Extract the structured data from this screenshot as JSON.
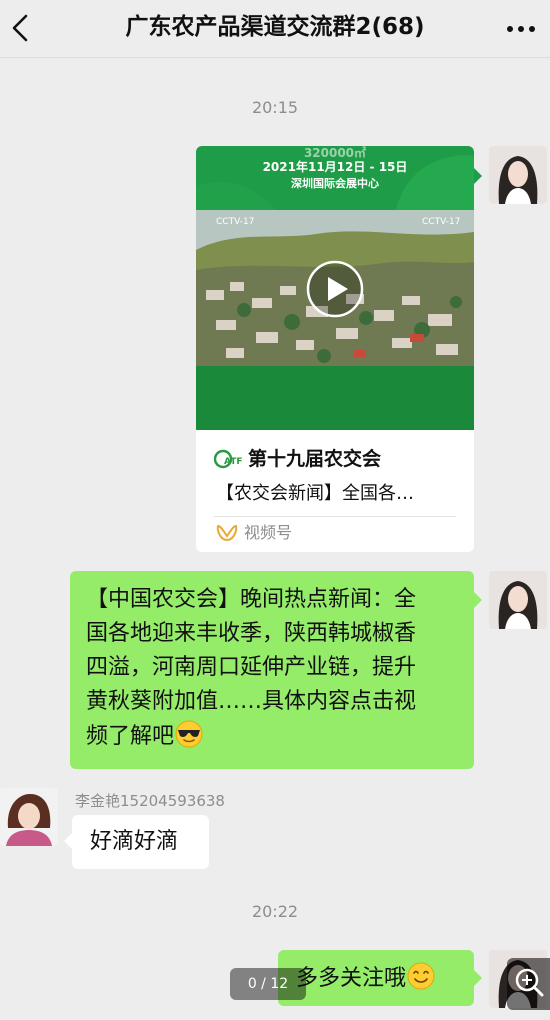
{
  "header": {
    "title": "广东农产品渠道交流群2(68)",
    "back_icon": "chevron-left-icon",
    "more_icon": "more-dots-icon"
  },
  "timestamps": [
    "20:15",
    "20:22"
  ],
  "video_card": {
    "banner_line1": "320000㎡",
    "banner_date": "2021年11月12日 - 15日",
    "banner_venue": "深圳国际会展中心",
    "watermark": "CCTV-17",
    "title": "第十九届农交会",
    "description": "【农交会新闻】全国各…",
    "source": "视频号",
    "logo_text": "CATF"
  },
  "messages": [
    {
      "side": "right",
      "text": "【中国农交会】晚间热点新闻：全国各地迎来丰收季，陕西韩城椒香四溢，河南周口延伸产业链，提升黄秋葵附加值……具体内容点击视频了解吧",
      "lines": [
        "【中国农交会】晚间热点新闻：全",
        "国各地迎来丰收季，陕西韩城椒香",
        "四溢，河南周口延伸产业链，提升",
        "黄秋葵附加值……具体内容点击视",
        "频了解吧"
      ],
      "emoji": "sunglasses-emoji"
    },
    {
      "side": "left",
      "sender": "李金艳15204593638",
      "text": "好滴好滴"
    },
    {
      "side": "right",
      "text": "多多关注哦",
      "emoji": "smile-emoji"
    }
  ],
  "overlay": {
    "page_indicator": "0 / 12",
    "zoom_icon": "zoom-in-icon"
  },
  "colors": {
    "background": "#ededed",
    "bubble_green": "#95ec69",
    "bubble_white": "#ffffff",
    "card_green": "#1f9c47"
  }
}
